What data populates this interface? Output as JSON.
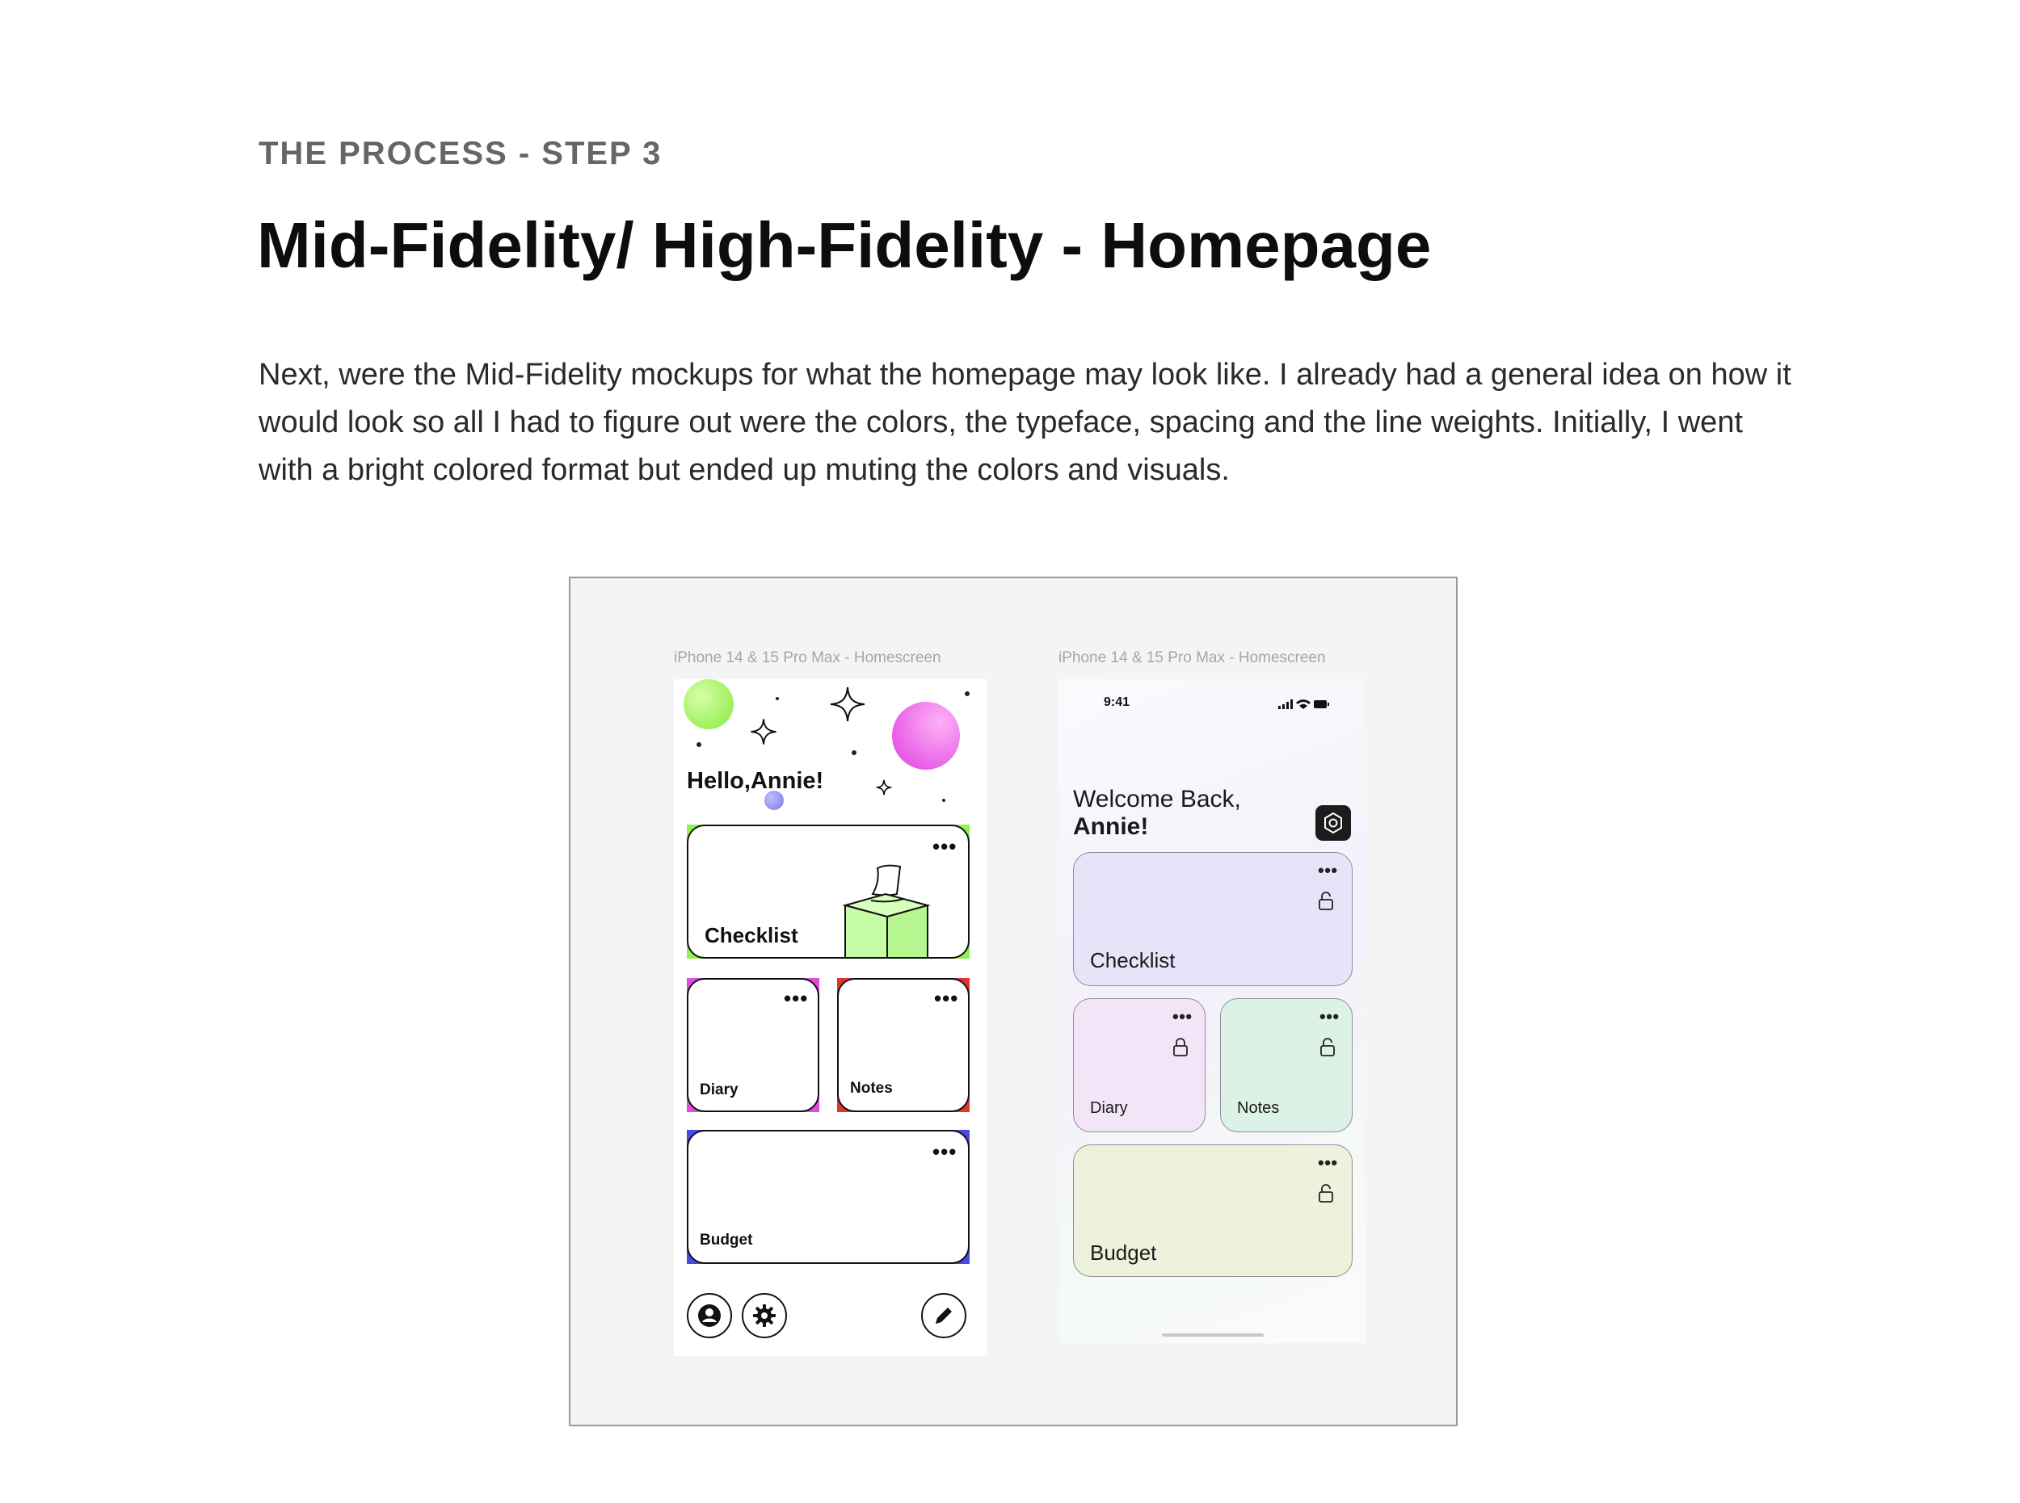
{
  "header": {
    "eyebrow": "THE PROCESS - STEP 3",
    "title": "Mid-Fidelity/ High-Fidelity - Homepage",
    "body": "Next, were the Mid-Fidelity mockups for what the homepage may look like. I already had a general idea on how it would look so all I had to figure out were the colors, the typeface, spacing and the line weights. Initially, I went with a bright colored format but ended up muting the colors and visuals."
  },
  "mockups": {
    "mid": {
      "frame_label": "iPhone 14 & 15 Pro Max - Homescreen",
      "greeting": "Hello,Annie!",
      "cards": {
        "checklist": "Checklist",
        "diary": "Diary",
        "notes": "Notes",
        "budget": "Budget"
      },
      "more_label": "•••",
      "icons": [
        "profile-icon",
        "gear-icon",
        "pencil-icon",
        "sparkle-icon",
        "tissue-box-illustration"
      ],
      "colors": {
        "green_accent": "#8ef24f",
        "pink_accent": "#e24be0",
        "red_accent": "#e5352b",
        "blue_accent": "#4b48e3"
      }
    },
    "hi": {
      "frame_label": "iPhone 14 & 15 Pro Max - Homescreen",
      "status_time": "9:41",
      "welcome_line1": "Welcome Back,",
      "welcome_line2": "Annie!",
      "cards": {
        "checklist": "Checklist",
        "diary": "Diary",
        "notes": "Notes",
        "budget": "Budget"
      },
      "more_label": "•••",
      "icons": [
        "settings-icon",
        "lock-icon",
        "signal-icon",
        "wifi-icon",
        "battery-icon"
      ],
      "colors": {
        "checklist_bg": "#e6e4f9",
        "diary_bg": "#f3e5f8",
        "notes_bg": "#ddf2e7",
        "budget_bg": "#eef1dc"
      }
    }
  }
}
